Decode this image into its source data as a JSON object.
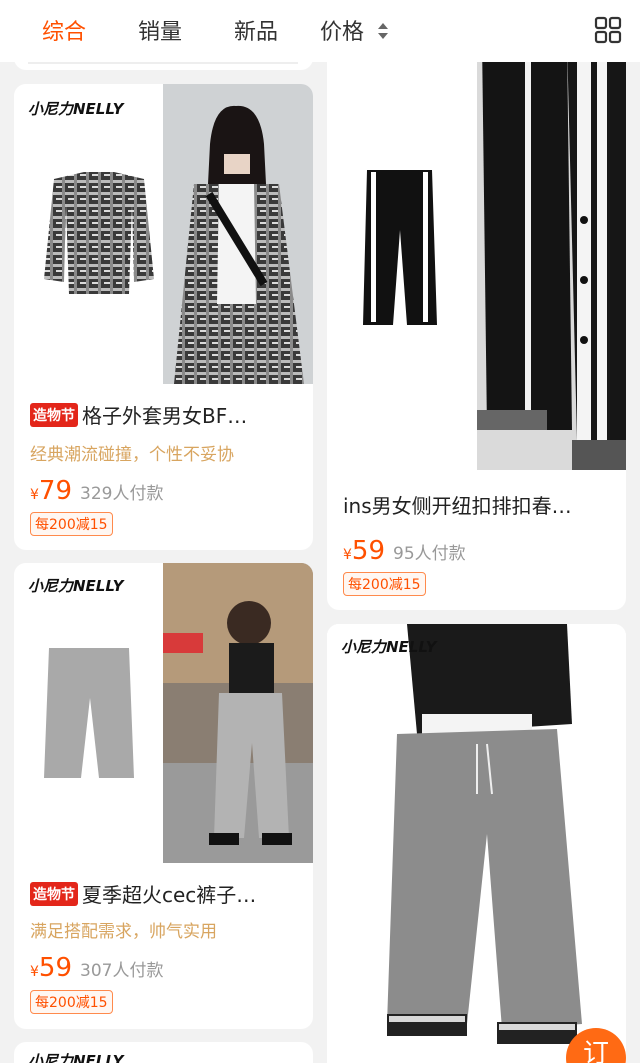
{
  "sort_tabs": {
    "comprehensive": "综合",
    "sales": "销量",
    "new": "新品",
    "price": "价格"
  },
  "colors": {
    "accent": "#ff5000",
    "tag_red": "#e3261a",
    "subtitle_gold": "#d8a560"
  },
  "icons": {
    "layout_toggle": "grid-view-icon",
    "sort": "sort-arrows-icon"
  },
  "products": [
    {
      "brand": "小尼力NELLY",
      "promo_tag": "造物节",
      "title": "格子外套男女BF…",
      "subtitle": "经典潮流碰撞，个性不妥协",
      "price_symbol": "¥",
      "price": "79",
      "sold": "329人付款",
      "coupon": "每200减15"
    },
    {
      "title": "ins男女侧开纽扣排扣春…",
      "price_symbol": "¥",
      "price": "59",
      "sold": "95人付款",
      "coupon": "每200减15"
    },
    {
      "brand": "小尼力NELLY",
      "promo_tag": "造物节",
      "title": "夏季超火cec裤子…",
      "subtitle": "满足搭配需求，帅气实用",
      "price_symbol": "¥",
      "price": "59",
      "sold": "307人付款",
      "coupon": "每200减15"
    },
    {
      "brand": "小尼力NELLY"
    },
    {
      "brand": "小尼力NELLY"
    }
  ],
  "float_button": "订"
}
